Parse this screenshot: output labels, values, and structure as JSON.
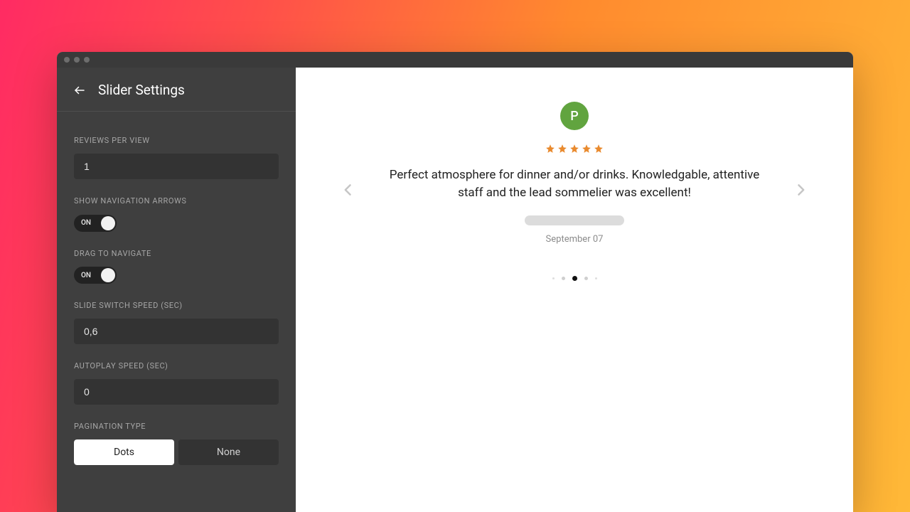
{
  "sidebar": {
    "title": "Slider Settings",
    "reviewsPerView": {
      "label": "REVIEWS PER VIEW",
      "value": "1"
    },
    "showArrows": {
      "label": "SHOW NAVIGATION ARROWS",
      "state": "ON"
    },
    "dragNav": {
      "label": "DRAG TO NAVIGATE",
      "state": "ON"
    },
    "switchSpeed": {
      "label": "SLIDE SWITCH SPEED (SEC)",
      "value": "0,6"
    },
    "autoplay": {
      "label": "AUTOPLAY SPEED (SEC)",
      "value": "0"
    },
    "pagination": {
      "label": "PAGINATION TYPE",
      "options": [
        "Dots",
        "None"
      ],
      "selected": "Dots"
    }
  },
  "preview": {
    "avatarLetter": "P",
    "stars": 5,
    "text": "Perfect atmosphere for dinner and/or drinks. Knowledgable, attentive staff and the lead sommelier was excellent!",
    "date": "September 07",
    "dotCount": 5,
    "activeDot": 2
  }
}
